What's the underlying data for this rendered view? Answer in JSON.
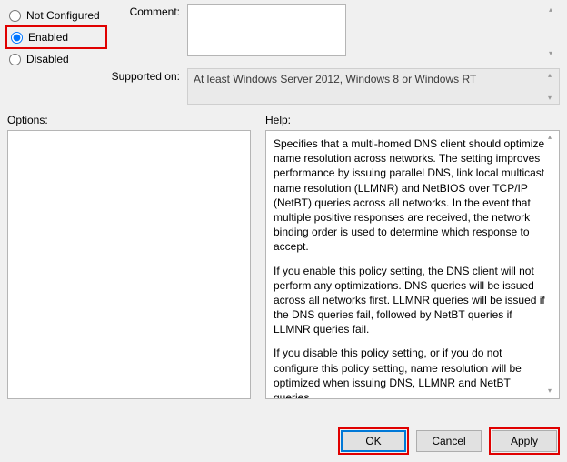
{
  "radios": {
    "not_configured": "Not Configured",
    "enabled": "Enabled",
    "disabled": "Disabled"
  },
  "meta": {
    "comment_label": "Comment:",
    "comment_value": "",
    "supported_label": "Supported on:",
    "supported_value": "At least Windows Server 2012, Windows 8 or Windows RT"
  },
  "sections": {
    "options_label": "Options:",
    "help_label": "Help:"
  },
  "help": {
    "p1": "Specifies that a multi-homed DNS client should optimize name resolution across networks.  The setting improves performance by issuing parallel DNS, link local multicast name resolution (LLMNR) and NetBIOS over TCP/IP (NetBT) queries across all networks. In the event that multiple positive responses are received, the network binding order is used to determine which response to accept.",
    "p2": "If you enable this policy setting, the DNS client will not perform any optimizations.  DNS queries will be issued across all networks first. LLMNR queries will be issued if the DNS queries fail, followed by NetBT queries if LLMNR queries fail.",
    "p3": "If you disable this policy setting, or if you do not configure this policy setting, name resolution will be optimized when issuing DNS, LLMNR and NetBT queries."
  },
  "buttons": {
    "ok": "OK",
    "cancel": "Cancel",
    "apply": "Apply"
  }
}
